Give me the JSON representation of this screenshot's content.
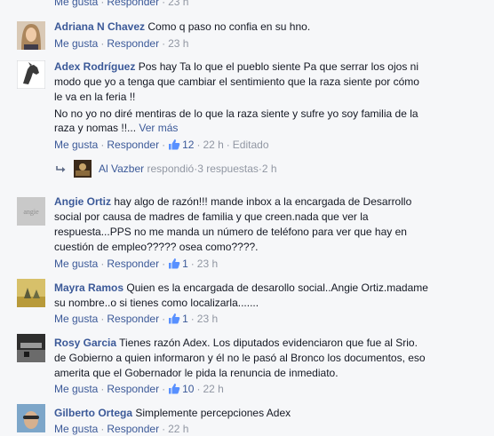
{
  "ui": {
    "like_label": "Me gusta",
    "reply_label": "Responder",
    "see_more": "Ver más",
    "colors": {
      "link": "#3b5998",
      "meta": "#9197a3",
      "text": "#141823",
      "background": "#f6f7f9"
    }
  },
  "top_partial": {
    "time": "23 h"
  },
  "comments": [
    {
      "author": "Adriana N Chavez",
      "lines": [
        "Como q paso no confia en su hno."
      ],
      "likes": "",
      "time": "23 h",
      "edited": ""
    },
    {
      "author": "Adex Rodríguez",
      "lines": [
        "Pos hay Ta lo que el pueblo siente Pa que serrar los ojos ni",
        "modo que yo a tenga que cambiar el sentimiento que la raza siente por cómo",
        "le va en la feria !!",
        "No no yo no diré mentiras de lo que la raza siente y sufre yo soy familia de la",
        "raza y nomas !!..."
      ],
      "likes": "12",
      "time": "22 h",
      "edited": "Editado",
      "reply_summary": {
        "author": "Al Vazber",
        "text": "respondió",
        "count": "3 respuestas",
        "time": "2 h"
      }
    },
    {
      "author": "Angie Ortiz",
      "lines": [
        "hay algo de razón!!! mande inbox a la encargada de Desarrollo",
        "social por causa de madres de familia y que creen.nada que ver la",
        "respuesta...PPS no me manda un número de teléfono para ver que hay en",
        "cuestión de empleo????? osea como????."
      ],
      "likes": "1",
      "time": "23 h",
      "edited": ""
    },
    {
      "author": "Mayra Ramos",
      "lines": [
        "Quien es la encargada de desarollo social..Angie Ortiz.madame",
        "su nombre..o si tienes como localizarla......."
      ],
      "likes": "1",
      "time": "23 h",
      "edited": ""
    },
    {
      "author": "Rosy Garcia",
      "lines": [
        "Tienes razón Adex. Los diputados evidenciaron que fue al Srio.",
        "de Gobierno a quien informaron y él no le pasó al Bronco los documentos, eso",
        "amerita que el Gobernador le pida la renuncia de inmediato."
      ],
      "likes": "10",
      "time": "22 h",
      "edited": ""
    },
    {
      "author": "Gilberto Ortega",
      "lines": [
        "Simplemente percepciones Adex"
      ],
      "likes": "",
      "time": "22 h",
      "edited": ""
    }
  ]
}
